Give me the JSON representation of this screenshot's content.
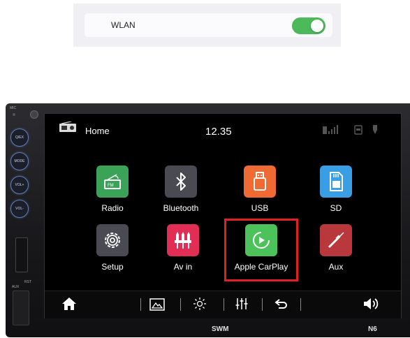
{
  "wlan": {
    "label": "WLAN",
    "enabled": true
  },
  "device": {
    "side_labels": {
      "mic": "MIC",
      "rst": "RST",
      "aux": "AUX"
    },
    "side_buttons": [
      "Q/EX",
      "MODE",
      "VOL+",
      "VOL-"
    ],
    "brand": "SWM",
    "model": "N6"
  },
  "screen": {
    "title": "Home",
    "time": "12.35",
    "apps": [
      {
        "label": "Radio",
        "icon": "radio-icon",
        "color": "#3aa357"
      },
      {
        "label": "Bluetooth",
        "icon": "bluetooth-icon",
        "color": "#4a4a52"
      },
      {
        "label": "USB",
        "icon": "usb-icon",
        "color": "#f06a33"
      },
      {
        "label": "SD",
        "icon": "sd-card-icon",
        "color": "#3a9ee4"
      },
      {
        "label": "Setup",
        "icon": "gear-icon",
        "color": "#4a4a52"
      },
      {
        "label": "Av in",
        "icon": "av-in-icon",
        "color": "#e22d55"
      },
      {
        "label": "Apple CarPlay",
        "icon": "carplay-icon",
        "color": "#4cc25a"
      },
      {
        "label": "Aux",
        "icon": "aux-cable-icon",
        "color": "#b8383c"
      }
    ],
    "bottom_icons": [
      "home-icon",
      "picture-icon",
      "brightness-icon",
      "equalizer-icon",
      "back-icon",
      "volume-icon"
    ]
  }
}
